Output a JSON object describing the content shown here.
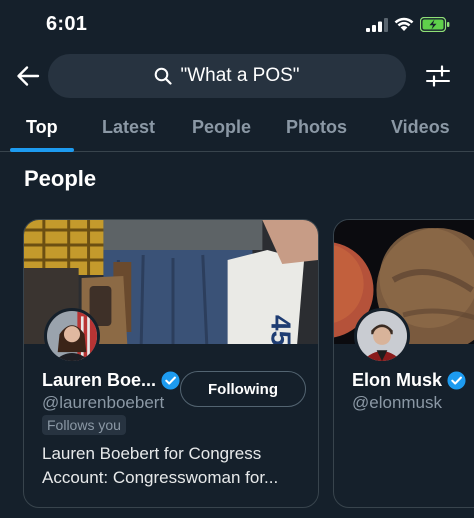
{
  "status_bar": {
    "time": "6:01",
    "icons": [
      "signal-icon",
      "wifi-icon",
      "battery-charging-icon"
    ]
  },
  "search": {
    "query": "\"What a POS\"",
    "icon": "search-icon"
  },
  "header": {
    "back_icon": "arrow-left-icon",
    "filter_icon": "sliders-icon"
  },
  "tabs": [
    {
      "label": "Top",
      "active": true
    },
    {
      "label": "Latest",
      "active": false
    },
    {
      "label": "People",
      "active": false
    },
    {
      "label": "Photos",
      "active": false
    },
    {
      "label": "Videos",
      "active": false
    }
  ],
  "section": {
    "title": "People"
  },
  "people": [
    {
      "name": "Lauren Boe...",
      "handle": "@laurenboebert",
      "verified": true,
      "follows_you": "Follows you",
      "button": "Following",
      "bio": "Lauren Boebert for Congress Account: Congresswoman for..."
    },
    {
      "name": "Elon Musk",
      "handle": "@elonmusk",
      "verified": true
    }
  ],
  "colors": {
    "background": "#15202b",
    "accent": "#1d9bf0",
    "secondary_text": "#8b98a5",
    "border": "#38444d"
  }
}
